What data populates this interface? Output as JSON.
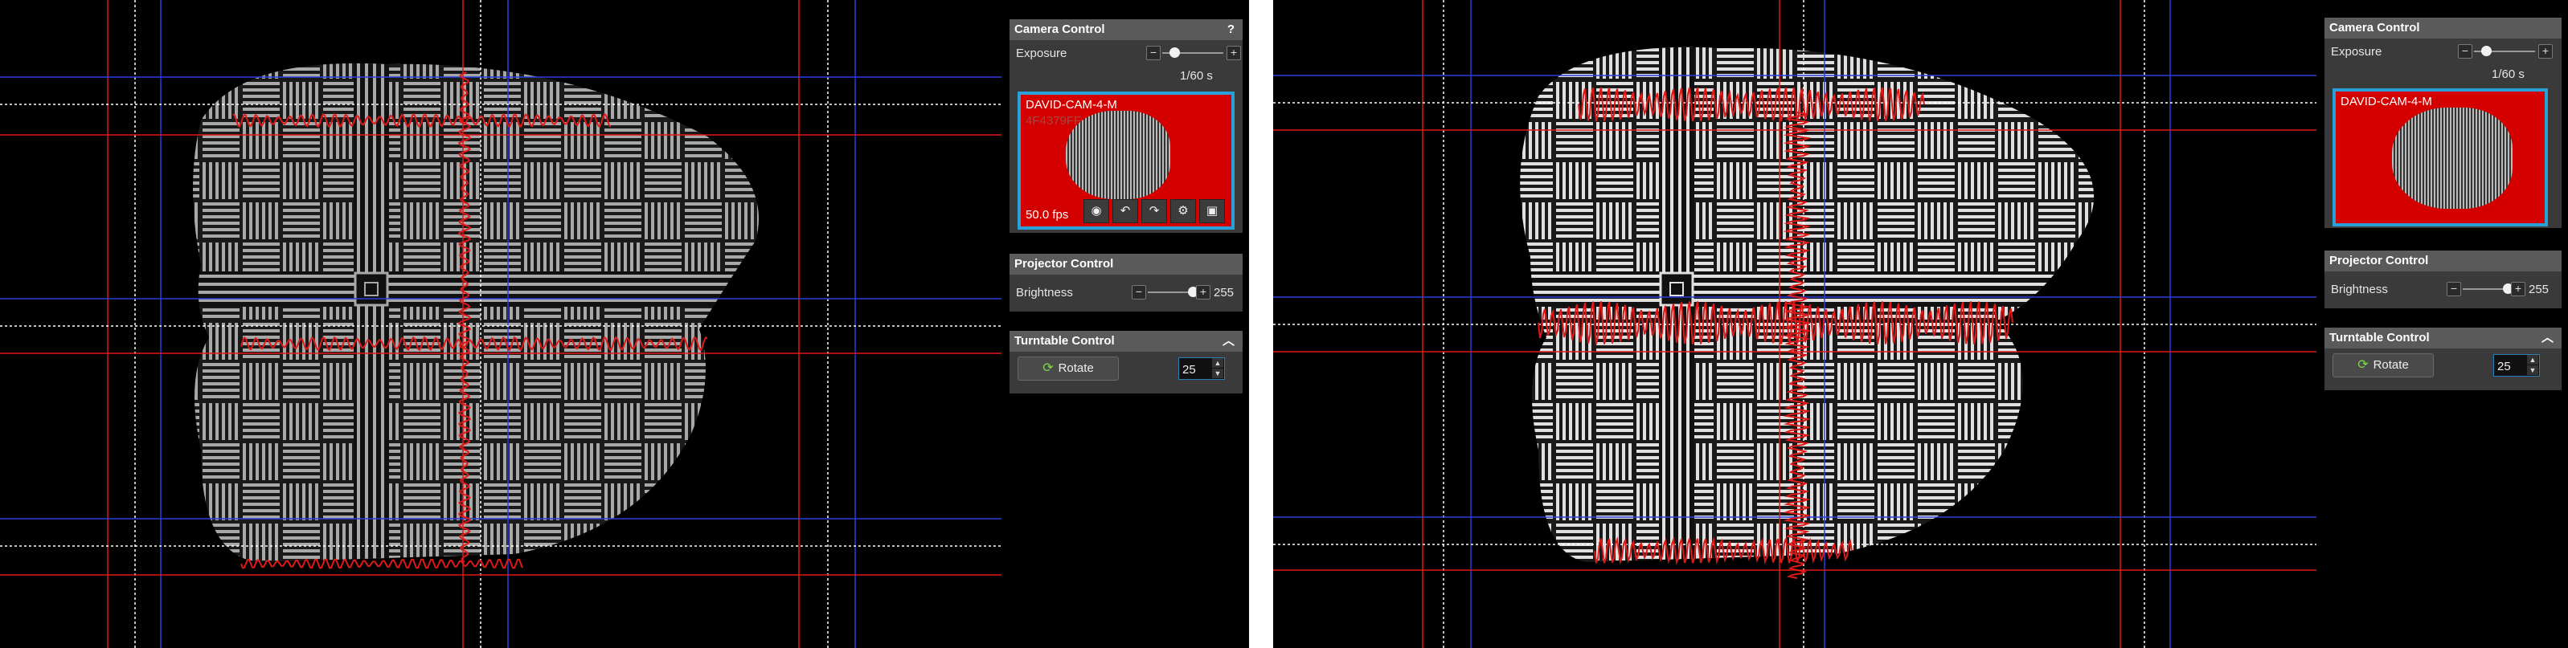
{
  "left": {
    "camera_control": {
      "title": "Camera Control",
      "help_label": "?",
      "exposure_label": "Exposure",
      "exposure_value": "1/60 s",
      "exposure_level": 0.2,
      "minus": "−",
      "plus": "+",
      "preview": {
        "camera_name": "DAVID-CAM-4-M",
        "camera_id": "4F4379FF",
        "fps": "50.0 fps"
      },
      "preview_tools": [
        "color-wheel-icon",
        "undo-icon",
        "redo-icon",
        "gear-icon",
        "camera-icon"
      ]
    },
    "projector_control": {
      "title": "Projector Control",
      "brightness_label": "Brightness",
      "brightness_value": "255",
      "brightness_level": 1.0
    },
    "turntable_control": {
      "title": "Turntable Control",
      "collapse_icon": "chevron-up-icon",
      "rotate_label": "Rotate",
      "rotate_icon": "refresh-icon",
      "angle_value": "25"
    }
  },
  "right": {
    "camera_control": {
      "title": "Camera Control",
      "exposure_label": "Exposure",
      "exposure_value": "1/60 s",
      "exposure_level": 0.2,
      "minus": "−",
      "plus": "+",
      "preview": {
        "camera_name": "DAVID-CAM-4-M"
      }
    },
    "projector_control": {
      "title": "Projector Control",
      "brightness_label": "Brightness",
      "brightness_value": "255",
      "brightness_level": 1.0
    },
    "turntable_control": {
      "title": "Turntable Control",
      "collapse_icon": "chevron-up-icon",
      "rotate_label": "Rotate",
      "rotate_icon": "refresh-icon",
      "angle_value": "25"
    }
  },
  "colors": {
    "panel_bg": "#3a3a3a",
    "panel_header": "#5a5a5a",
    "preview_bg": "#d40000",
    "preview_border": "#2aa0d8",
    "overlay_red": "#e01818",
    "overlay_blue": "#2b3fe0",
    "overlay_dotted": "#ffffff"
  }
}
